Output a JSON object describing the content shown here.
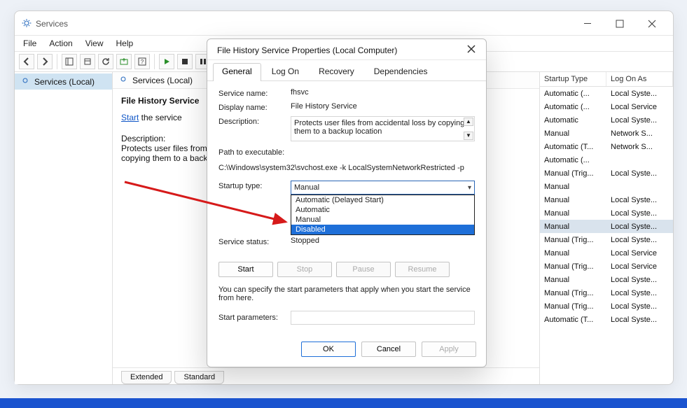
{
  "app": {
    "title": "Services",
    "menus": [
      "File",
      "Action",
      "View",
      "Help"
    ]
  },
  "tree": {
    "node_label": "Services (Local)"
  },
  "central": {
    "heading": "Services (Local)"
  },
  "detail": {
    "selected_service": "File History Service",
    "start_link": "Start",
    "start_suffix": " the service",
    "desc_label": "Description:",
    "desc_text": "Protects user files from accidental loss by copying them to a backup location"
  },
  "tabs_bottom": {
    "extended": "Extended",
    "standard": "Standard"
  },
  "columns_visible": {
    "startup": "Startup Type",
    "logon": "Log On As"
  },
  "rows": [
    {
      "startup": "Automatic (...",
      "logon": "Local Syste..."
    },
    {
      "startup": "Automatic (...",
      "logon": "Local Service"
    },
    {
      "startup": "Automatic",
      "logon": "Local Syste..."
    },
    {
      "startup": "Manual",
      "logon": "Network S..."
    },
    {
      "startup": "Automatic (T...",
      "logon": "Network S..."
    },
    {
      "startup": "Automatic (...",
      "logon": ""
    },
    {
      "startup": "Manual (Trig...",
      "logon": "Local Syste..."
    },
    {
      "startup": "Manual",
      "logon": ""
    },
    {
      "startup": "Manual",
      "logon": "Local Syste..."
    },
    {
      "startup": "Manual",
      "logon": "Local Syste..."
    },
    {
      "startup": "Manual",
      "logon": "Local Syste...",
      "selected": true
    },
    {
      "startup": "Manual (Trig...",
      "logon": "Local Syste..."
    },
    {
      "startup": "Manual",
      "logon": "Local Service"
    },
    {
      "startup": "Manual (Trig...",
      "logon": "Local Service"
    },
    {
      "startup": "Manual",
      "logon": "Local Syste..."
    },
    {
      "startup": "Manual (Trig...",
      "logon": "Local Syste..."
    },
    {
      "startup": "Manual (Trig...",
      "logon": "Local Syste..."
    },
    {
      "startup": "Automatic (T...",
      "logon": "Local Syste..."
    }
  ],
  "props": {
    "title": "File History Service Properties (Local Computer)",
    "tabs": {
      "general": "General",
      "logon": "Log On",
      "recovery": "Recovery",
      "deps": "Dependencies"
    },
    "service_name_label": "Service name:",
    "service_name": "fhsvc",
    "display_name_label": "Display name:",
    "display_name": "File History Service",
    "description_label": "Description:",
    "description": "Protects user files from accidental loss by copying them to a backup location",
    "path_label": "Path to executable:",
    "path": "C:\\Windows\\system32\\svchost.exe -k LocalSystemNetworkRestricted -p",
    "startup_type_label": "Startup type:",
    "startup_selected": "Manual",
    "startup_options": [
      "Automatic (Delayed Start)",
      "Automatic",
      "Manual",
      "Disabled"
    ],
    "startup_highlight": "Disabled",
    "service_status_label": "Service status:",
    "service_status": "Stopped",
    "actions": {
      "start": "Start",
      "stop": "Stop",
      "pause": "Pause",
      "resume": "Resume"
    },
    "note": "You can specify the start parameters that apply when you start the service from here.",
    "start_params_label": "Start parameters:",
    "start_params_value": "",
    "footer": {
      "ok": "OK",
      "cancel": "Cancel",
      "apply": "Apply"
    }
  }
}
